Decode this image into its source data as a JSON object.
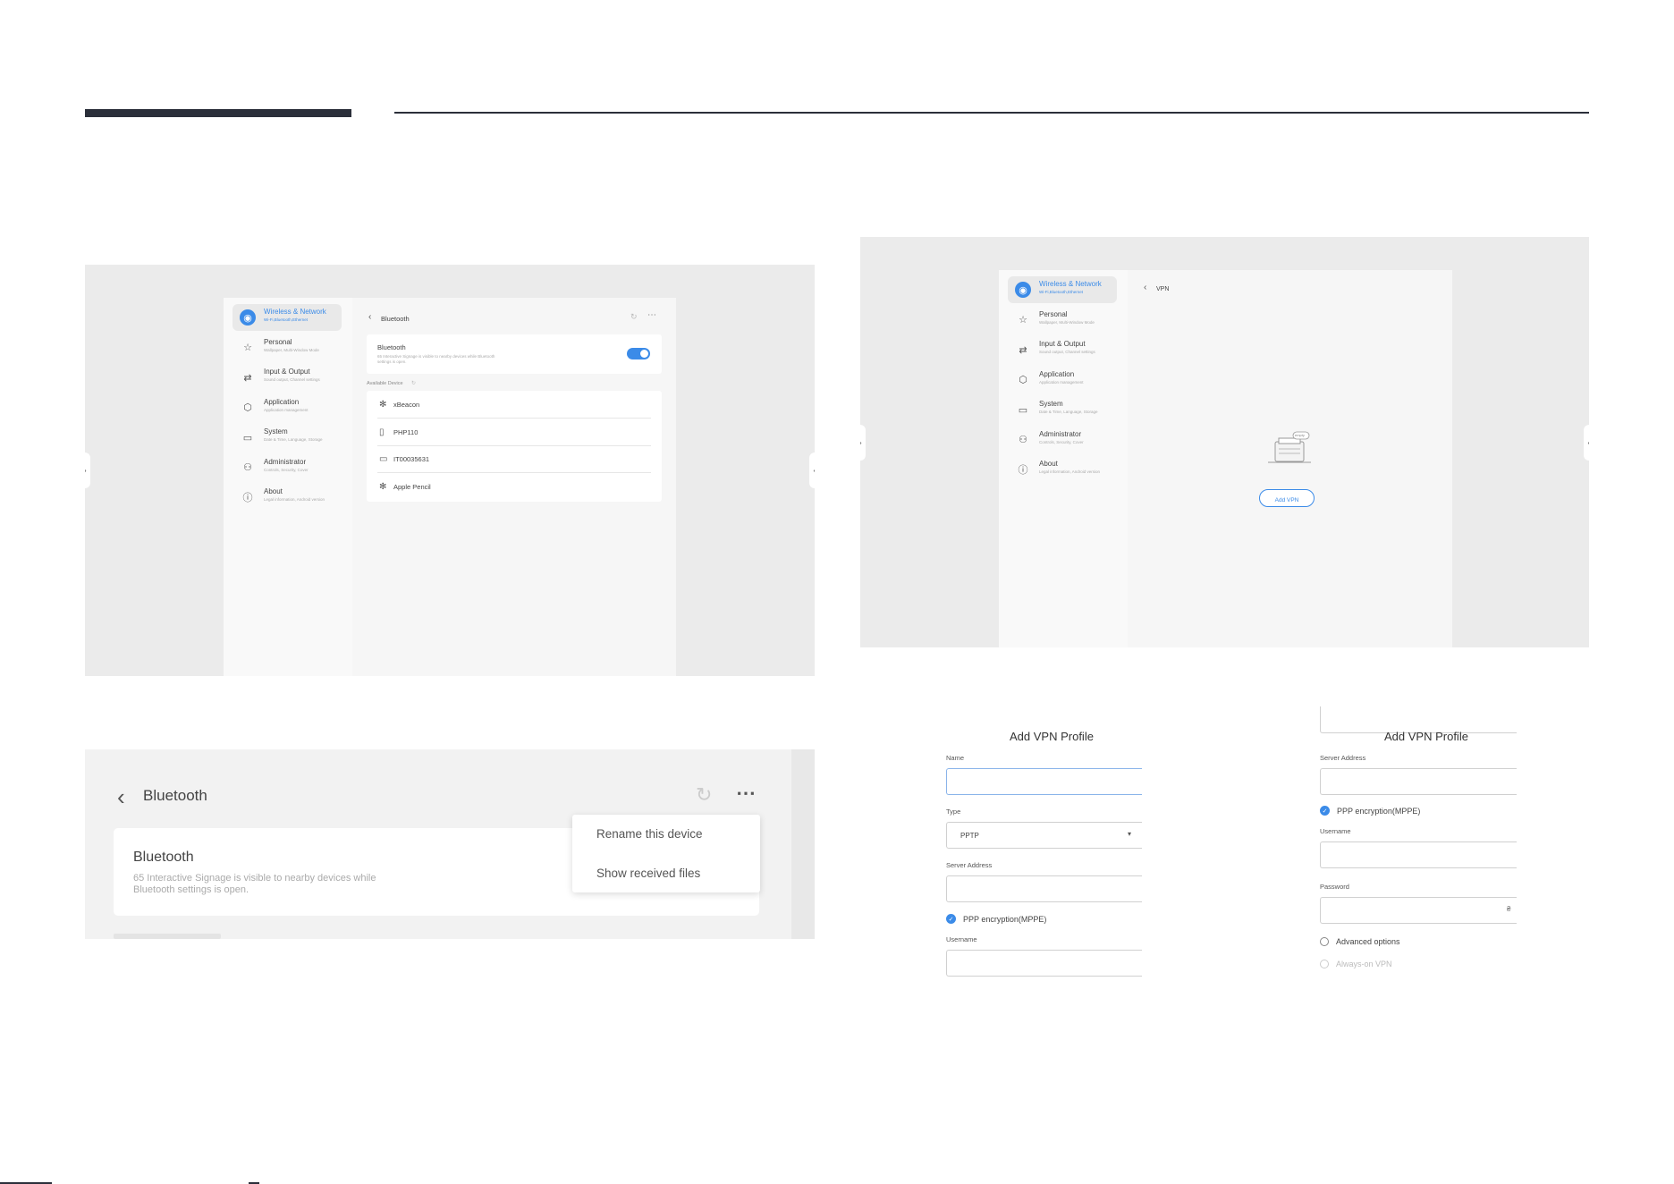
{
  "colors": {
    "accent": "#3b8be8",
    "header": "#2b2f3a"
  },
  "nav": [
    {
      "title": "Wireless & Network",
      "sub": "Wi-Fi,Bluetooth,Ethernet",
      "icon": "wifi-icon"
    },
    {
      "title": "Personal",
      "sub": "Wallpaper, Multi-Window Mode",
      "icon": "star-icon"
    },
    {
      "title": "Input & Output",
      "sub": "Sound output, Channel settings",
      "icon": "swap-arrows-icon"
    },
    {
      "title": "Application",
      "sub": "Application management",
      "icon": "cube-icon"
    },
    {
      "title": "System",
      "sub": "Date & Time, Language, Storage",
      "icon": "monitor-icon"
    },
    {
      "title": "Administrator",
      "sub": "Controls, Security, Cover",
      "icon": "person-icon"
    },
    {
      "title": "About",
      "sub": "Legal information, Android version",
      "icon": "info-icon"
    }
  ],
  "bt_screen": {
    "title": "Bluetooth",
    "toggle_title": "Bluetooth",
    "toggle_desc": "65 Interactive Signage is visible to nearby devices while Bluetooth settings is open.",
    "available": "Available Device",
    "devices": [
      {
        "name": "xBeacon",
        "icon": "bluetooth-icon"
      },
      {
        "name": "PHP110",
        "icon": "phone-icon"
      },
      {
        "name": "IT00035631",
        "icon": "monitor-icon"
      },
      {
        "name": "Apple Pencil",
        "icon": "bluetooth-icon"
      }
    ]
  },
  "vpn_screen": {
    "title": "VPN",
    "add_button": "Add VPN",
    "empty_label": "empty"
  },
  "zoom": {
    "title": "Bluetooth",
    "card_title": "Bluetooth",
    "card_desc_1": "65 Interactive Signage is visible to nearby devices while",
    "card_desc_2": "Bluetooth settings is open.",
    "menu": [
      "Rename this device",
      "Show received files"
    ]
  },
  "form1": {
    "title": "Add VPN Profile",
    "name_label": "Name",
    "type_label": "Type",
    "type_value": "PPTP",
    "server_label": "Server Address",
    "ppp_label": "PPP encryption(MPPE)",
    "username_label": "Username"
  },
  "form2": {
    "title": "Add VPN Profile",
    "server_label": "Server Address",
    "ppp_label": "PPP encryption(MPPE)",
    "username_label": "Username",
    "password_label": "Password",
    "advanced_label": "Advanced options",
    "always_label": "Always-on VPN"
  }
}
